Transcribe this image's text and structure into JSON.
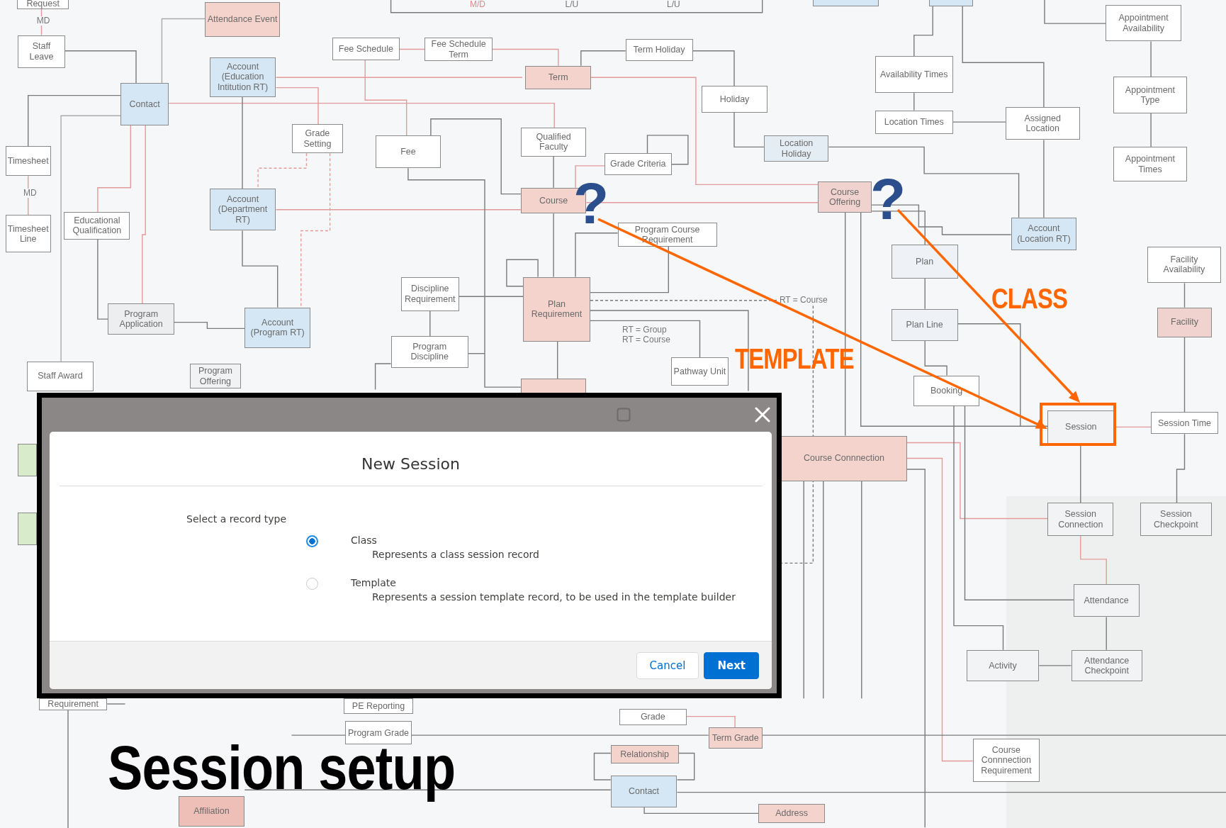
{
  "diagram": {
    "entities": [
      {
        "label": "Request",
        "color": "#ffffff",
        "highlighted": false
      },
      {
        "label": "Attendance Event",
        "color": "#f5d3cd",
        "highlighted": false
      },
      {
        "color": "#d5e7f4",
        "highlighted": false
      },
      {
        "color": "#d5e7f4",
        "highlighted": false
      },
      {
        "label": "Appointment Availability",
        "color": "#ffffff",
        "highlighted": false
      },
      {
        "label": "Staff Leave",
        "color": "#ffffff",
        "highlighted": false
      },
      {
        "label": "Fee Schedule",
        "color": "#ffffff",
        "highlighted": false
      },
      {
        "label": "Fee Schedule Term",
        "color": "#ffffff",
        "highlighted": false
      },
      {
        "label": "Term Holiday",
        "color": "#ffffff",
        "highlighted": false
      },
      {
        "label": "Contact",
        "color": "#d5e7f4",
        "highlighted": false
      },
      {
        "label": "Account (Education Intitution RT)",
        "color": "#d5e7f4",
        "highlighted": false
      },
      {
        "label": "Term",
        "color": "#f5d3cd",
        "highlighted": false
      },
      {
        "label": "Holiday",
        "color": "#ffffff",
        "highlighted": false
      },
      {
        "label": "Availability Times",
        "color": "#ffffff",
        "highlighted": false
      },
      {
        "label": "Appointment Type",
        "color": "#ffffff",
        "highlighted": false
      },
      {
        "label": "Location Times",
        "color": "#ffffff",
        "highlighted": false
      },
      {
        "label": "Assigned Location",
        "color": "#ffffff",
        "highlighted": false
      },
      {
        "label": "Timesheet",
        "color": "#ffffff",
        "highlighted": false
      },
      {
        "label": "Grade Setting",
        "color": "#ffffff",
        "highlighted": false
      },
      {
        "label": "Fee",
        "color": "#ffffff",
        "highlighted": false
      },
      {
        "label": "Qualified Faculty",
        "color": "#ffffff",
        "highlighted": false
      },
      {
        "label": "Grade Criteria",
        "color": "#ffffff",
        "highlighted": false
      },
      {
        "label": "Location Holiday",
        "color": "#e4edf4",
        "highlighted": false
      },
      {
        "label": "Appointment Times",
        "color": "#ffffff",
        "highlighted": false
      },
      {
        "label": "Account (Department RT)",
        "color": "#d5e7f4",
        "highlighted": false
      },
      {
        "label": "Course",
        "color": "#f5d3cd",
        "highlighted": false
      },
      {
        "label": "Course Offering",
        "color": "#f0d2ce",
        "highlighted": false
      },
      {
        "label": "Timesheet Line",
        "color": "#ffffff",
        "highlighted": false
      },
      {
        "label": "Educational Qualification",
        "color": "#ffffff",
        "highlighted": false
      },
      {
        "label": "Program Course Requirement",
        "color": "#ffffff",
        "highlighted": false
      },
      {
        "label": "Plan",
        "color": "#eef2f6",
        "highlighted": false
      },
      {
        "label": "Account (Location RT)",
        "color": "#d5e7f4",
        "highlighted": false
      },
      {
        "label": "Facility Availability",
        "color": "#ffffff",
        "highlighted": false
      },
      {
        "label": "Program Application",
        "color": "#eceef0",
        "highlighted": false
      },
      {
        "label": "Account (Program RT)",
        "color": "#d5e7f4",
        "highlighted": false
      },
      {
        "label": "Discipline Requirement",
        "color": "#ffffff",
        "highlighted": false
      },
      {
        "label": "Plan Requirement",
        "color": "#f5d3cd",
        "highlighted": false
      },
      {
        "label": "Plan Line",
        "color": "#eef2f6",
        "highlighted": false
      },
      {
        "label": "Facility",
        "color": "#f0d2ce",
        "highlighted": false
      },
      {
        "label": "Staff Award",
        "color": "#ffffff",
        "highlighted": false
      },
      {
        "label": "Program Offering",
        "color": "#f1f2f3",
        "highlighted": false
      },
      {
        "label": "Program Discipline",
        "color": "#ffffff",
        "highlighted": false
      },
      {
        "color": "#f5d3cd",
        "highlighted": false
      },
      {
        "label": "Pathway Unit",
        "color": "#ffffff",
        "highlighted": false
      },
      {
        "label": "Booking",
        "color": "#ffffff",
        "highlighted": false
      },
      {
        "label": "Session",
        "color": "#f1f3f5",
        "highlighted": true
      },
      {
        "label": "Session Time",
        "color": "#ffffff",
        "highlighted": false
      },
      {
        "color": "#d8ebcb",
        "highlighted": false
      },
      {
        "label": "Course Connnection",
        "color": "#f5d3cd",
        "highlighted": false
      },
      {
        "color": "#d8ebcb",
        "highlighted": false
      },
      {
        "label": "Session Connection",
        "color": "#f1f3f5",
        "highlighted": false
      },
      {
        "label": "Session Checkpoint",
        "color": "#f1f3f5",
        "highlighted": false
      },
      {
        "label": "Attendance",
        "color": "#f1f3f5",
        "highlighted": false
      },
      {
        "label": "Activity",
        "color": "#f1f3f5",
        "highlighted": false
      },
      {
        "label": "Attendance Checkpoint",
        "color": "#f1f3f5",
        "highlighted": false
      },
      {
        "label": "Requirement",
        "color": "#ffffff",
        "highlighted": false
      },
      {
        "label": "PE Reporting",
        "color": "#ffffff",
        "highlighted": false
      },
      {
        "label": "Program Grade",
        "color": "#ffffff",
        "highlighted": false
      },
      {
        "label": "Grade",
        "color": "#ffffff",
        "highlighted": false
      },
      {
        "label": "Relationship",
        "color": "#f5d3cd",
        "highlighted": false
      },
      {
        "label": "Term Grade",
        "color": "#f5d3cd",
        "highlighted": false
      },
      {
        "label": "Course Connnection Requirement",
        "color": "#ffffff",
        "highlighted": false
      },
      {
        "label": "Affiliation",
        "color": "#eebfb7",
        "highlighted": false
      },
      {
        "label": "Contact",
        "color": "#d5e7f4",
        "highlighted": false
      },
      {
        "label": "Address",
        "color": "#f5d3cd",
        "highlighted": false
      }
    ],
    "labels": [
      {
        "text": "M/D",
        "color": "#e08a8a"
      },
      {
        "text": "L/U",
        "color": "#777777"
      },
      {
        "text": "L/U",
        "color": "#777777"
      },
      {
        "text": "MD",
        "color": "#777777"
      },
      {
        "text": "MD",
        "color": "#777777"
      },
      {
        "text": "RT = Course",
        "color": "#777777"
      },
      {
        "text": "RT = Group",
        "color": "#777777"
      },
      {
        "text": "RT = Course",
        "color": "#777777"
      }
    ]
  },
  "annotations": {
    "question_marks": [
      "?",
      "?"
    ],
    "arrows": [
      {
        "label": "TEMPLATE"
      },
      {
        "label": "CLASS"
      }
    ]
  },
  "dialog": {
    "title": "New Session",
    "field_label": "Select a record type",
    "options": [
      {
        "label": "Class",
        "description": "Represents a class session record",
        "selected": true
      },
      {
        "label": "Template",
        "description": "Represents a session template record, to be used in the template builder",
        "selected": false
      }
    ],
    "buttons": [
      {
        "label": "Cancel",
        "kind": "neutral"
      },
      {
        "label": "Next",
        "kind": "brand"
      }
    ]
  },
  "title": "Session setup"
}
